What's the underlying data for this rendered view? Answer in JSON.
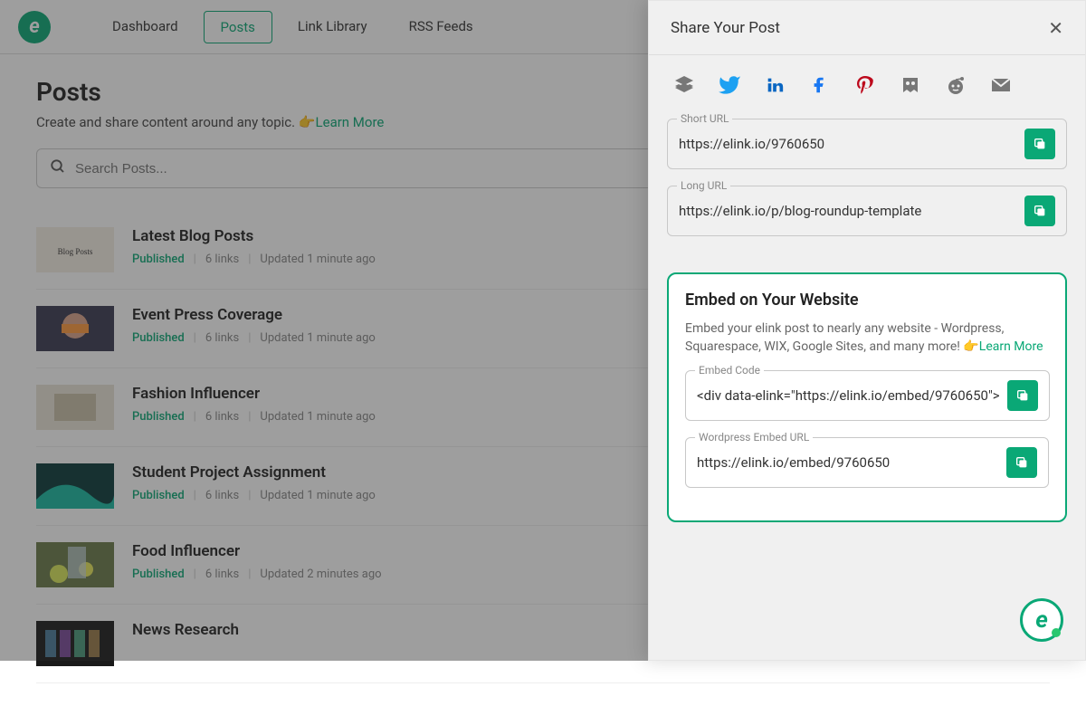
{
  "nav": {
    "dashboard": "Dashboard",
    "posts": "Posts",
    "link_library": "Link Library",
    "rss": "RSS Feeds"
  },
  "page": {
    "title": "Posts",
    "subtitle": "Create and share content around any topic.",
    "learn_more": "Learn More",
    "search_placeholder": "Search Posts..."
  },
  "posts": [
    {
      "title": "Latest Blog Posts",
      "status": "Published",
      "links": "6 links",
      "updated": "Updated 1 minute ago"
    },
    {
      "title": "Event Press Coverage",
      "status": "Published",
      "links": "6 links",
      "updated": "Updated 1 minute ago"
    },
    {
      "title": "Fashion Influencer",
      "status": "Published",
      "links": "6 links",
      "updated": "Updated 1 minute ago"
    },
    {
      "title": "Student Project Assignment",
      "status": "Published",
      "links": "6 links",
      "updated": "Updated 1 minute ago"
    },
    {
      "title": "Food Influencer",
      "status": "Published",
      "links": "6 links",
      "updated": "Updated 2 minutes ago"
    },
    {
      "title": "News Research",
      "status": "",
      "links": "",
      "updated": ""
    }
  ],
  "panel": {
    "title": "Share Your Post",
    "short_url_label": "Short URL",
    "short_url": "https://elink.io/9760650",
    "long_url_label": "Long URL",
    "long_url": "https://elink.io/p/blog-roundup-template",
    "embed_title": "Embed on Your Website",
    "embed_desc": "Embed your elink post to nearly any website - Wordpress, Squarespace, WIX, Google Sites, and many more!",
    "embed_learn": "Learn More",
    "embed_code_label": "Embed Code",
    "embed_code": "<div data-elink=\"https://elink.io/embed/9760650\">",
    "wp_label": "Wordpress Embed URL",
    "wp_url": "https://elink.io/embed/9760650"
  },
  "social": [
    "buffer",
    "twitter",
    "linkedin",
    "facebook",
    "pinterest",
    "hootsuite",
    "reddit",
    "email"
  ]
}
